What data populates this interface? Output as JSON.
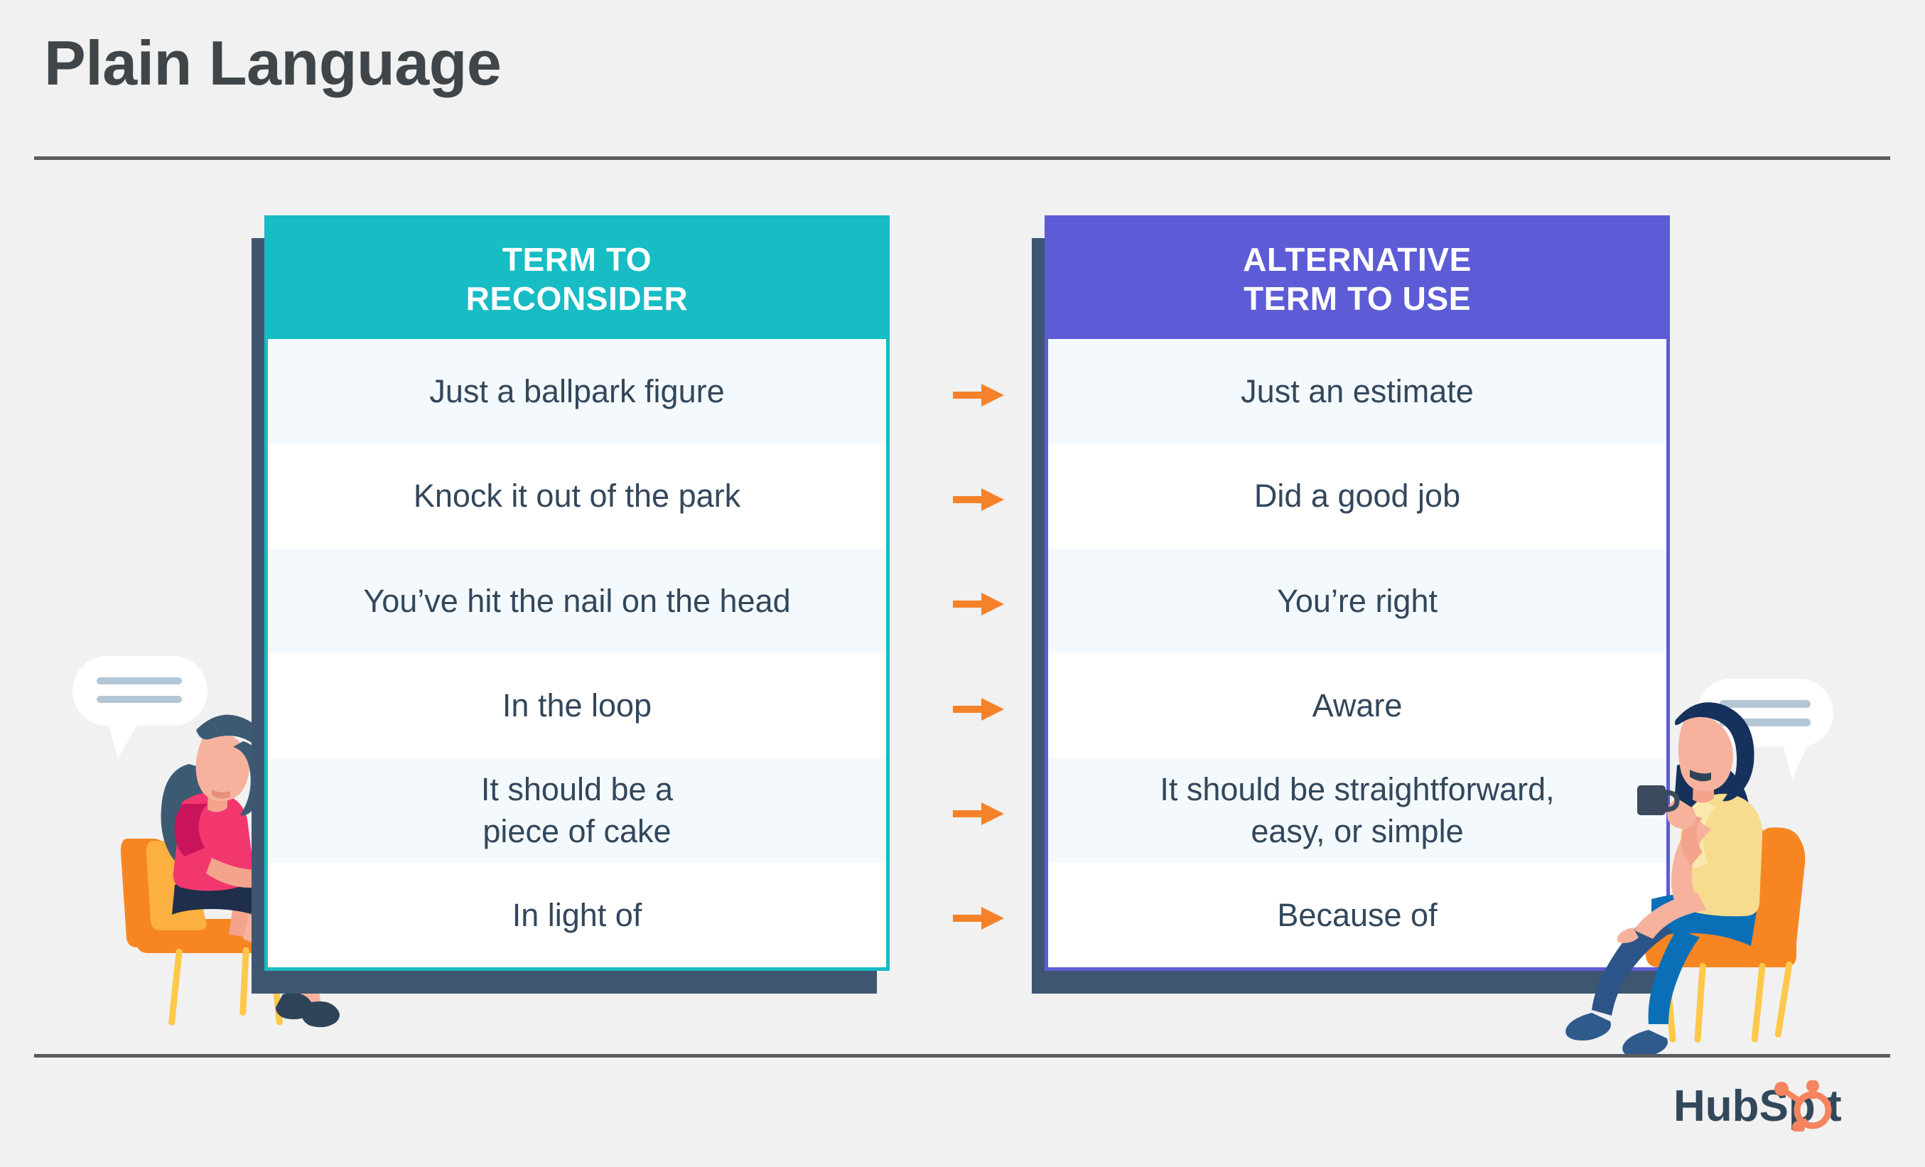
{
  "page": {
    "title": "Plain Language",
    "background_color": "#f0f1f0",
    "rule_color": "#5a5d5f"
  },
  "columns": {
    "left": {
      "header": "TERM TO\nRECONSIDER",
      "header_line1": "TERM TO",
      "header_line2": "RECONSIDER",
      "accent_color": "#17bcc4",
      "shadow_color": "#3f5670"
    },
    "right": {
      "header": "ALTERNATIVE\nTERM TO USE",
      "header_line1": "ALTERNATIVE",
      "header_line2": "TERM TO USE",
      "accent_color": "#5d5cd6",
      "shadow_color": "#3f5670"
    }
  },
  "rows": [
    {
      "term": "Just a ballpark figure",
      "alternative": "Just an estimate",
      "arrow": "arrow-right-icon"
    },
    {
      "term": "Knock it out of the park",
      "alternative": "Did a good job",
      "arrow": "arrow-right-icon"
    },
    {
      "term": "You’ve hit the nail on the head",
      "alternative": "You’re right",
      "arrow": "arrow-right-icon"
    },
    {
      "term": "In the loop",
      "alternative": "Aware",
      "arrow": "arrow-right-icon"
    },
    {
      "term": "It should be a\npiece of cake",
      "alternative": "It should be straightforward,\neasy, or simple",
      "arrow": "arrow-right-icon"
    },
    {
      "term": "In light of",
      "alternative": "Because of",
      "arrow": "arrow-right-icon"
    }
  ],
  "row_text_color": "#33475b",
  "row_stripe_colors": [
    "#f4f9fd",
    "#ffffff"
  ],
  "arrow_color": "#f5822a",
  "illustrations": {
    "left": {
      "name": "woman-seated-with-mug",
      "speech_bubble": "speech-bubble-icon",
      "hair_color": "#3d5a73",
      "top_color": "#f2376f",
      "skirt_color": "#1f2e4a",
      "chair_color": "#f99032",
      "mug_color": "#1a7fc1"
    },
    "right": {
      "name": "woman-seated-with-mug",
      "speech_bubble": "speech-bubble-icon",
      "hair_color": "#16325c",
      "top_color": "#f7dc8f",
      "pants_color": "#0b6fb8",
      "chair_color": "#f99032",
      "mug_color": "#3b4a5e"
    }
  },
  "footer": {
    "logo": {
      "name": "hubspot-logo",
      "wordmark": "HubSpot",
      "text_color": "#33475b",
      "sprocket_color": "#f5845f"
    }
  }
}
